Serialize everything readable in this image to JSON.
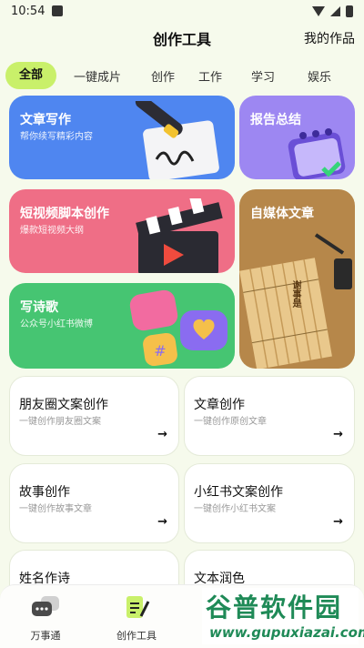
{
  "status_bar": {
    "time": "10:54"
  },
  "header": {
    "title": "创作工具",
    "my_works": "我的作品"
  },
  "tabs": [
    "全部",
    "一键成片",
    "创作",
    "工作",
    "学习",
    "娱乐"
  ],
  "feature_cards": {
    "article": {
      "title": "文章写作",
      "subtitle": "帮你续写精彩内容"
    },
    "report": {
      "title": "报告总结"
    },
    "video": {
      "title": "短视频脚本创作",
      "subtitle": "爆款短视频大纲"
    },
    "media": {
      "title": "自媒体文章",
      "scroll_text": "谢事是"
    },
    "poem": {
      "title": "写诗歌",
      "subtitle": "公众号小红书微博"
    }
  },
  "tools": [
    {
      "title": "朋友圈文案创作",
      "subtitle": "一键创作朋友圈文案"
    },
    {
      "title": "文章创作",
      "subtitle": "一键创作原创文章"
    },
    {
      "title": "故事创作",
      "subtitle": "一键创作故事文章"
    },
    {
      "title": "小红书文案创作",
      "subtitle": "一键创作小红书文案"
    },
    {
      "title": "姓名作诗"
    },
    {
      "title": "文本润色"
    }
  ],
  "bottom_nav": [
    {
      "label": "万事通",
      "icon": "chat-bubbles-icon"
    },
    {
      "label": "创作工具",
      "icon": "pen-document-icon"
    }
  ],
  "watermark": {
    "big": "谷普软件园",
    "small": "www.gupuxiazai.com"
  },
  "colors": {
    "accent": "#c9f06a",
    "article_card": "#4f86f0",
    "report_card": "#9d87f2",
    "video_card": "#ef6e86",
    "media_card": "#b6874a",
    "poem_card": "#46c572",
    "watermark": "#1f8a57"
  }
}
